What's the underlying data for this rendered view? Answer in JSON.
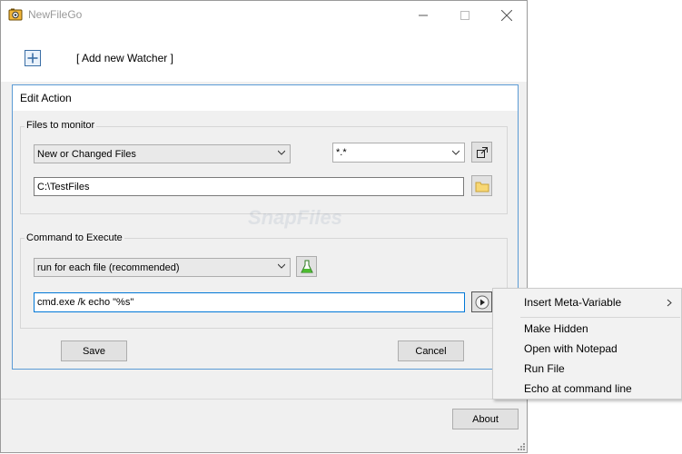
{
  "window": {
    "title": "NewFileGo"
  },
  "toolbar": {
    "add_watcher_label": "[ Add new Watcher ]"
  },
  "edit_action": {
    "title": "Edit Action",
    "files_group": {
      "label": "Files to monitor",
      "mode_value": "New or Changed Files",
      "filter_value": "*.*",
      "path_value": "C:\\TestFiles"
    },
    "command_group": {
      "label": "Command to Execute",
      "mode_value": "run for each file  (recommended)",
      "command_value": "cmd.exe /k echo \"%s\""
    },
    "save_label": "Save",
    "cancel_label": "Cancel"
  },
  "footer": {
    "about_label": "About"
  },
  "context_menu": {
    "items": [
      {
        "label": "Insert Meta-Variable"
      },
      {
        "label": "Make Hidden"
      },
      {
        "label": "Open with Notepad"
      },
      {
        "label": "Run File"
      },
      {
        "label": "Echo at command line"
      }
    ]
  },
  "watermark": {
    "text": "SnapFiles"
  },
  "colors": {
    "accent_border": "#5b9bd5",
    "window_bg": "#f0f0f0"
  },
  "icons": [
    "app-icon",
    "add-icon",
    "external-link-icon",
    "folder-icon",
    "flask-icon",
    "play-icon",
    "chevron-right-icon"
  ]
}
